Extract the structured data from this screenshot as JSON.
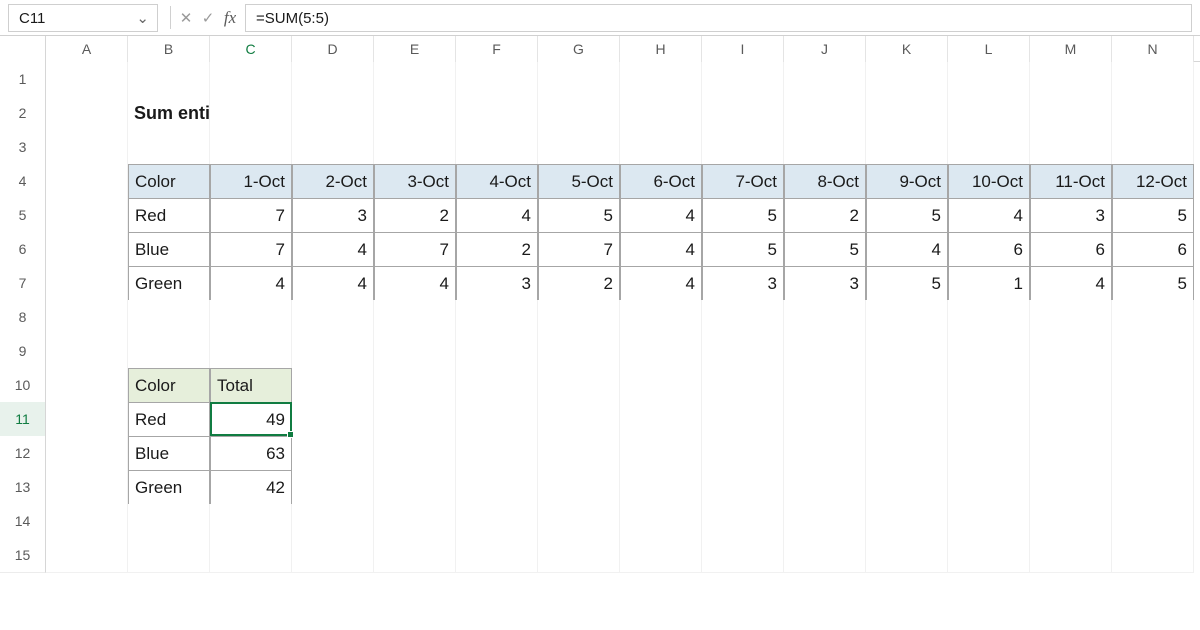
{
  "name_box": "C11",
  "formula": "=SUM(5:5)",
  "title": "Sum entire row",
  "columns": [
    "A",
    "B",
    "C",
    "D",
    "E",
    "F",
    "G",
    "H",
    "I",
    "J",
    "K",
    "L",
    "M",
    "N"
  ],
  "rows": [
    "1",
    "2",
    "3",
    "4",
    "5",
    "6",
    "7",
    "8",
    "9",
    "10",
    "11",
    "12",
    "13",
    "14",
    "15"
  ],
  "active_col": "C",
  "active_row": "11",
  "table1": {
    "headers": [
      "Color",
      "1-Oct",
      "2-Oct",
      "3-Oct",
      "4-Oct",
      "5-Oct",
      "6-Oct",
      "7-Oct",
      "8-Oct",
      "9-Oct",
      "10-Oct",
      "11-Oct",
      "12-Oct"
    ],
    "rows": [
      [
        "Red",
        "7",
        "3",
        "2",
        "4",
        "5",
        "4",
        "5",
        "2",
        "5",
        "4",
        "3",
        "5"
      ],
      [
        "Blue",
        "7",
        "4",
        "7",
        "2",
        "7",
        "4",
        "5",
        "5",
        "4",
        "6",
        "6",
        "6"
      ],
      [
        "Green",
        "4",
        "4",
        "4",
        "3",
        "2",
        "4",
        "3",
        "3",
        "5",
        "1",
        "4",
        "5"
      ]
    ]
  },
  "table2": {
    "headers": [
      "Color",
      "Total"
    ],
    "rows": [
      [
        "Red",
        "49"
      ],
      [
        "Blue",
        "63"
      ],
      [
        "Green",
        "42"
      ]
    ]
  }
}
